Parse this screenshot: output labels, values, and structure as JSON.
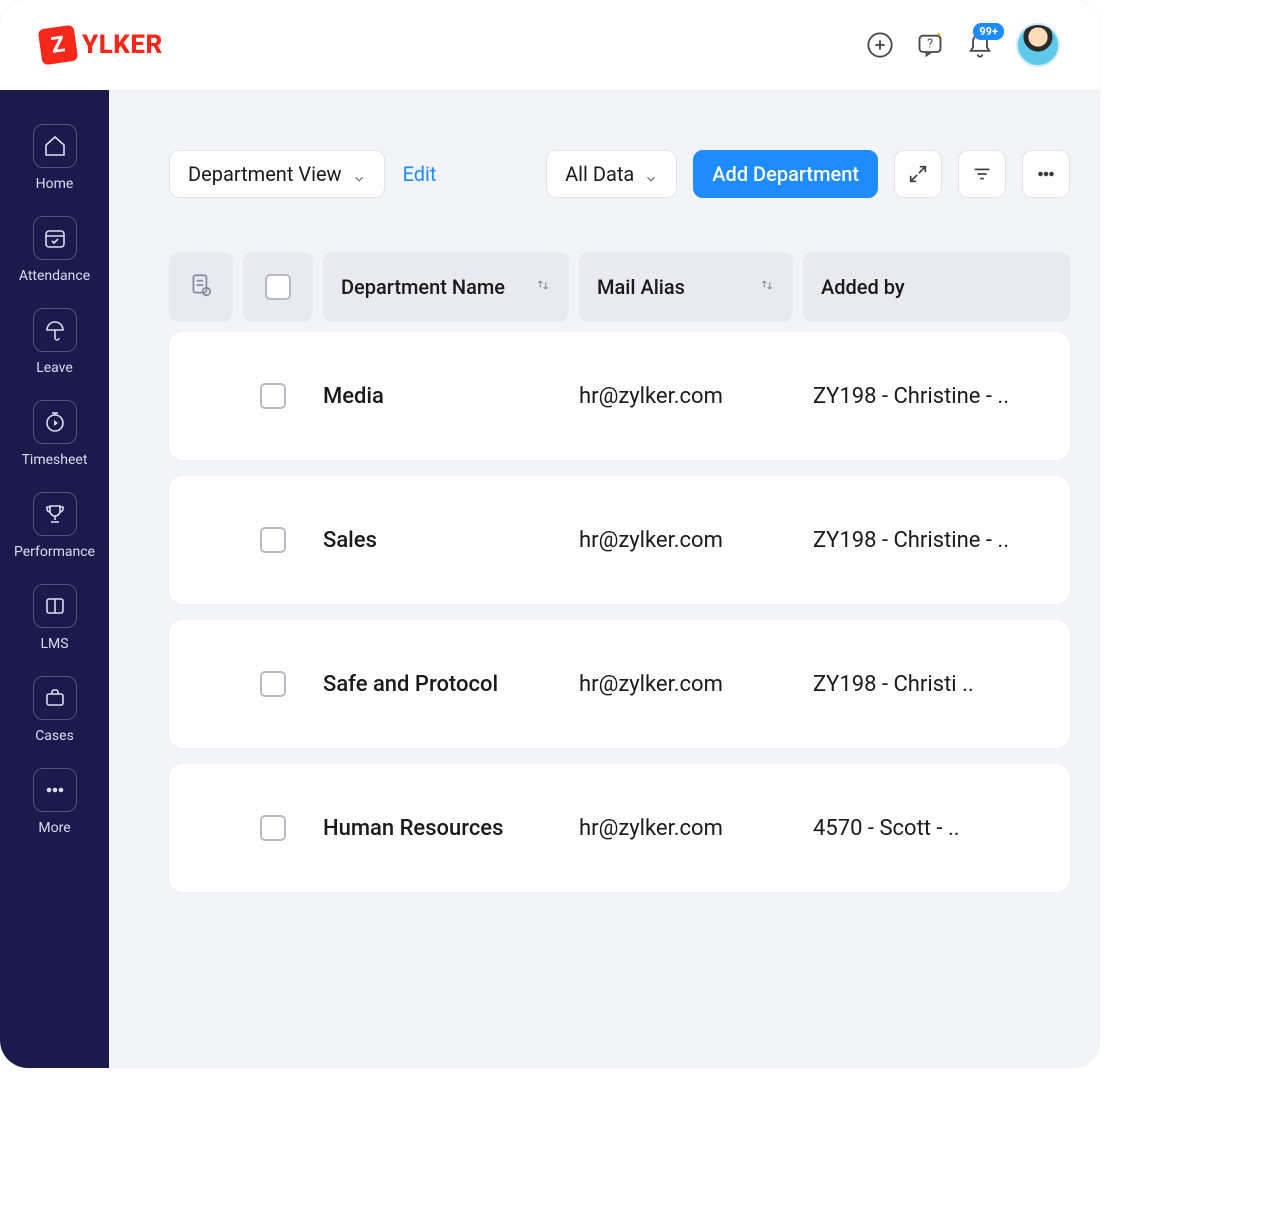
{
  "brand": {
    "badge_letter": "Z",
    "name": "YLKER"
  },
  "topbar": {
    "notif_badge": "99+"
  },
  "sidebar": {
    "items": [
      {
        "label": "Home"
      },
      {
        "label": "Attendance"
      },
      {
        "label": "Leave"
      },
      {
        "label": "Timesheet"
      },
      {
        "label": "Performance"
      },
      {
        "label": "LMS"
      },
      {
        "label": "Cases"
      },
      {
        "label": "More"
      }
    ]
  },
  "toolbar": {
    "view_label": "Department View",
    "edit_label": "Edit",
    "filter_label": "All Data",
    "add_label": "Add Department"
  },
  "columns": {
    "name": "Department Name",
    "mail": "Mail Alias",
    "added": "Added by"
  },
  "rows": [
    {
      "name": "Media",
      "mail": "hr@zylker.com",
      "added": "ZY198 - Christine - .."
    },
    {
      "name": "Sales",
      "mail": "hr@zylker.com",
      "added": "ZY198 - Christine - .."
    },
    {
      "name": "Safe and Protocol",
      "mail": "hr@zylker.com",
      "added": "ZY198 - Christi .."
    },
    {
      "name": "Human Resources",
      "mail": "hr@zylker.com",
      "added": "4570 - Scott - .."
    }
  ]
}
